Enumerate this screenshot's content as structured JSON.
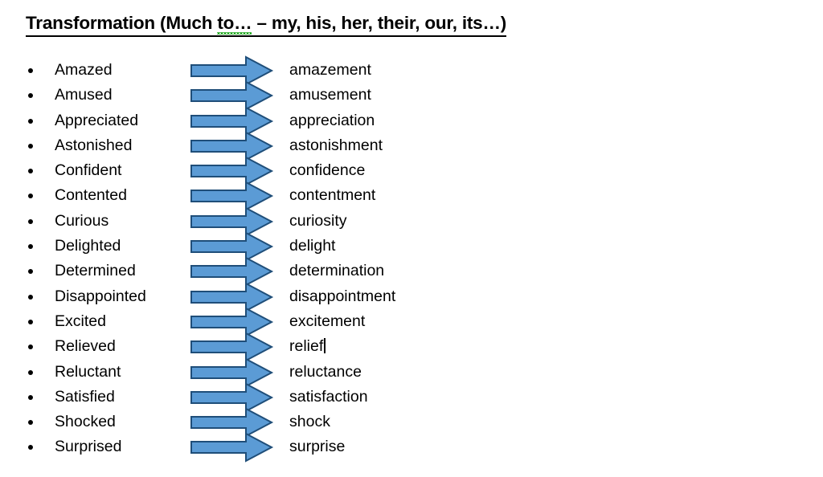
{
  "document": {
    "title_prefix": "Transformation (Much ",
    "title_misspelled": "to…",
    "title_suffix": " – my, his, her, their, our, its…)",
    "title_full": "Transformation (Much to… – my, his, her, their, our, its…)"
  },
  "colors": {
    "arrow_fill": "#5B9BD5",
    "arrow_stroke": "#1F4E79",
    "text": "#000000",
    "spellcheck_underline": "#13A313",
    "page_background": "#FFFFFF"
  },
  "arrow": {
    "icon_name": "right-arrow-icon",
    "count": 16
  },
  "list": {
    "bullet_glyph": "•",
    "items": [
      {
        "source": "Amazed",
        "target": "amazement"
      },
      {
        "source": "Amused",
        "target": "amusement"
      },
      {
        "source": "Appreciated",
        "target": "appreciation"
      },
      {
        "source": "Astonished",
        "target": "astonishment"
      },
      {
        "source": "Confident",
        "target": "confidence"
      },
      {
        "source": "Contented",
        "target": "contentment"
      },
      {
        "source": "Curious",
        "target": "curiosity"
      },
      {
        "source": "Delighted",
        "target": "delight"
      },
      {
        "source": "Determined",
        "target": "determination"
      },
      {
        "source": "Disappointed",
        "target": "disappointment"
      },
      {
        "source": "Excited",
        "target": "excitement"
      },
      {
        "source": "Relieved",
        "target": "relief",
        "caret_after": true
      },
      {
        "source": "Reluctant",
        "target": "reluctance"
      },
      {
        "source": "Satisfied",
        "target": "satisfaction"
      },
      {
        "source": "Shocked",
        "target": "shock"
      },
      {
        "source": "Surprised",
        "target": "surprise"
      }
    ]
  }
}
